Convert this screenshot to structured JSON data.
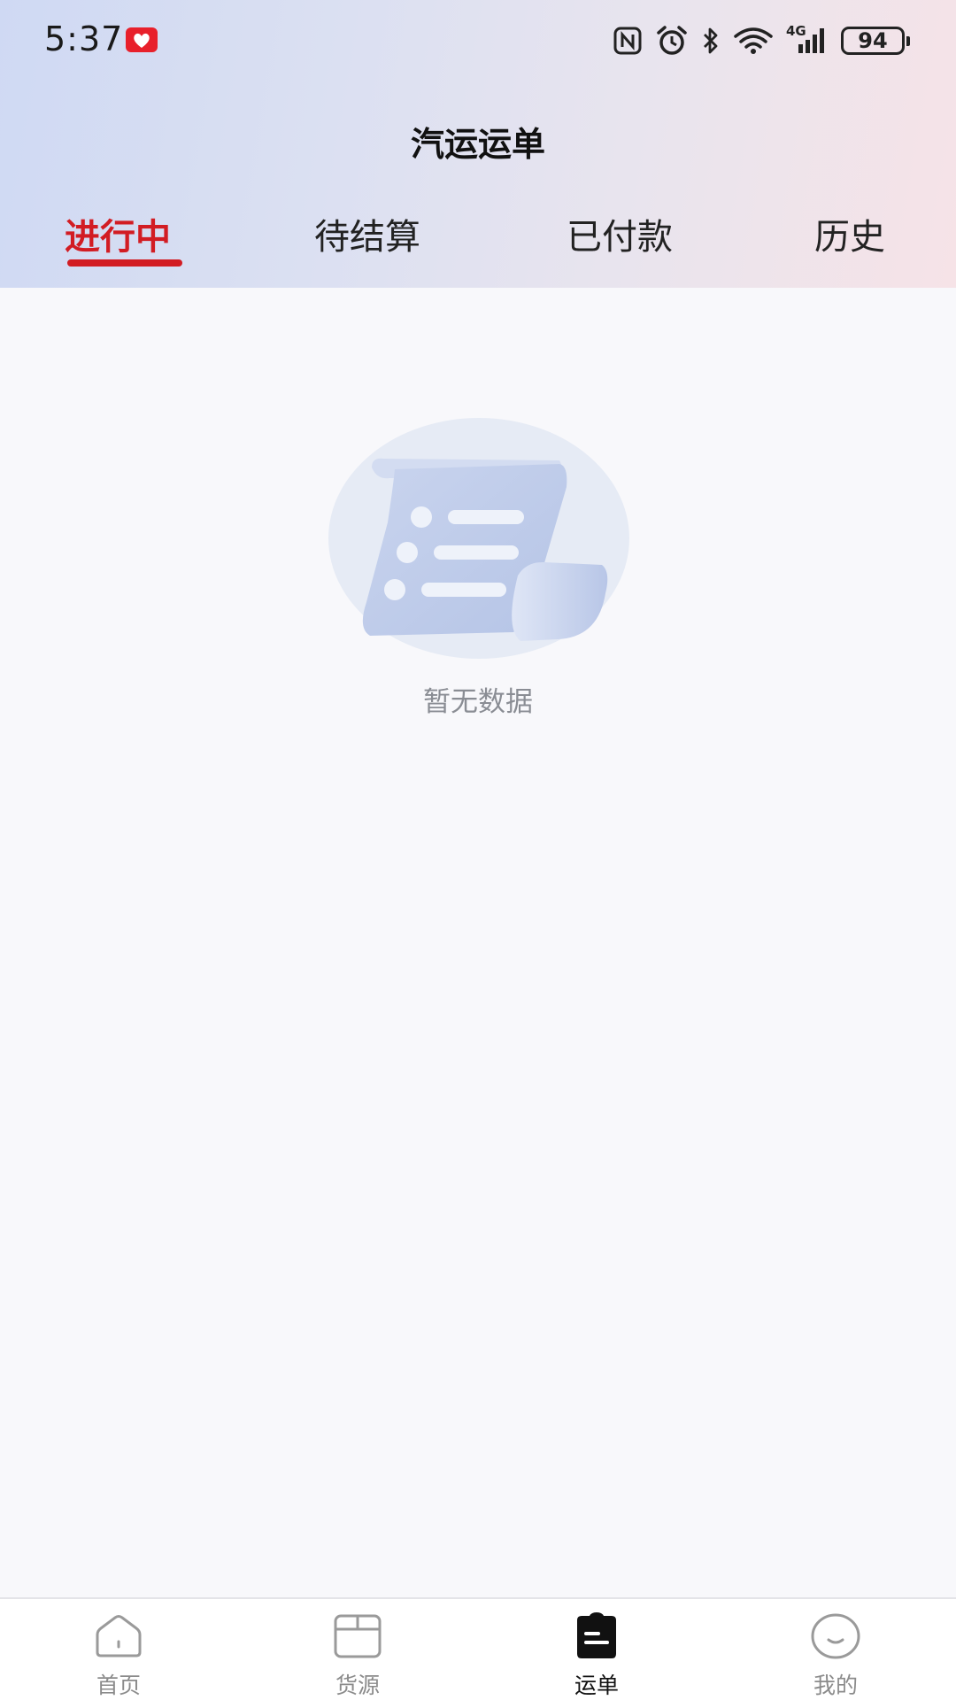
{
  "status_bar": {
    "time": "5:37",
    "battery": "94",
    "network": "4G",
    "icons": [
      "nfc-icon",
      "alarm-icon",
      "bluetooth-icon",
      "wifi-icon",
      "cellular-signal-icon",
      "battery-icon"
    ]
  },
  "header": {
    "title": "汽运运单"
  },
  "tabs": [
    {
      "label": "进行中",
      "active": true
    },
    {
      "label": "待结算",
      "active": false
    },
    {
      "label": "已付款",
      "active": false
    },
    {
      "label": "历史",
      "active": false
    }
  ],
  "empty_state": {
    "message": "暂无数据",
    "icon": "empty-scroll-illustration"
  },
  "bottom_nav": [
    {
      "label": "首页",
      "icon": "home-icon",
      "active": false
    },
    {
      "label": "货源",
      "icon": "box-icon",
      "active": false
    },
    {
      "label": "运单",
      "icon": "waybill-icon",
      "active": true
    },
    {
      "label": "我的",
      "icon": "profile-icon",
      "active": false
    }
  ],
  "colors": {
    "accent": "#d21c23",
    "page_background": "#f8f8fb",
    "muted_text": "#8a8d94"
  }
}
